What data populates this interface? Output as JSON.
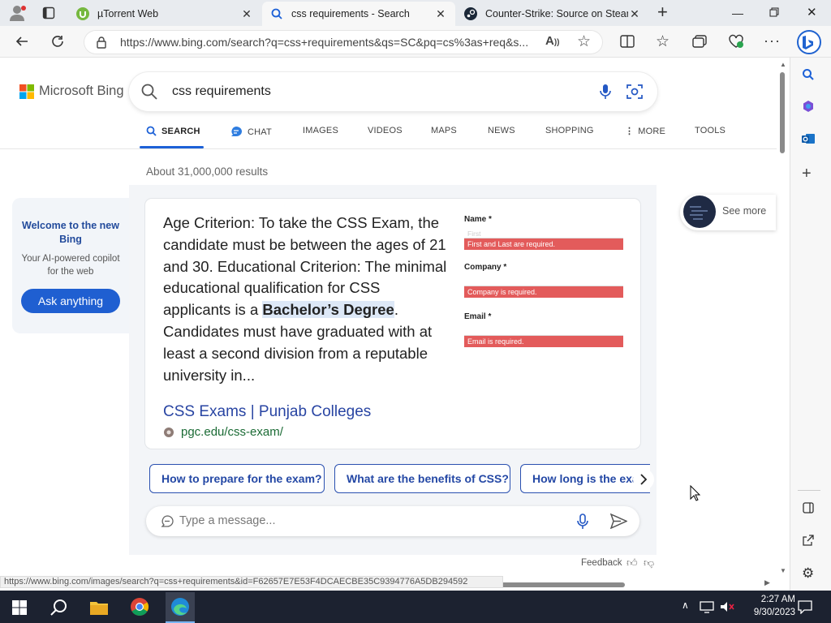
{
  "browser": {
    "tabs": [
      {
        "title": "µTorrent Web",
        "icon": "utorrent-icon"
      },
      {
        "title": "css requirements - Search",
        "icon": "search-icon",
        "active": true
      },
      {
        "title": "Counter-Strike: Source on Steam",
        "icon": "steam-icon"
      }
    ],
    "url": "https://www.bing.com/search?q=css+requirements&qs=SC&pq=cs%3as+req&s...",
    "status_url": "https://www.bing.com/images/search?q=css+requirements&id=F62657E7E53F4DCAECBE35C9394776A5DB294592"
  },
  "bing": {
    "logo_text": "Microsoft Bing",
    "query": "css requirements",
    "nav": [
      "SEARCH",
      "CHAT",
      "IMAGES",
      "VIDEOS",
      "MAPS",
      "NEWS",
      "SHOPPING",
      "MORE",
      "TOOLS"
    ],
    "result_count": "About 31,000,000 results",
    "welcome": {
      "title": "Welcome to the new Bing",
      "subtitle": "Your AI-powered copilot for the web",
      "button": "Ask anything"
    },
    "answer": {
      "text_before": "Age Criterion: To take the CSS Exam, the candidate must be between the ages of 21 and 30. Educational Criterion: The minimal educational qualification for CSS applicants is a ",
      "highlight": "Bachelor’s Degree",
      "text_after": ". Candidates must have graduated with at least a second division from a reputable university in...",
      "source_title": "CSS Exams | Punjab Colleges",
      "source_url": "pgc.edu/css-exam/"
    },
    "form_image": {
      "name_label": "Name *",
      "name_placeholder": "First",
      "name_error": "First and Last are required.",
      "company_label": "Company *",
      "company_error": "Company is required.",
      "email_label": "Email *",
      "email_error": "Email is required."
    },
    "suggestions": [
      "How to prepare for the exam?",
      "What are the benefits of CSS?",
      "How long is the exa"
    ],
    "message_placeholder": "Type a message...",
    "see_more": "See more",
    "feedback": "Feedback"
  },
  "taskbar": {
    "time": "2:27 AM",
    "date": "9/30/2023"
  },
  "colors": {
    "accent": "#1d61d7",
    "link": "#2945a3",
    "url_green": "#1b6b35",
    "error": "#e35b5b",
    "taskbar": "#1c2230"
  }
}
